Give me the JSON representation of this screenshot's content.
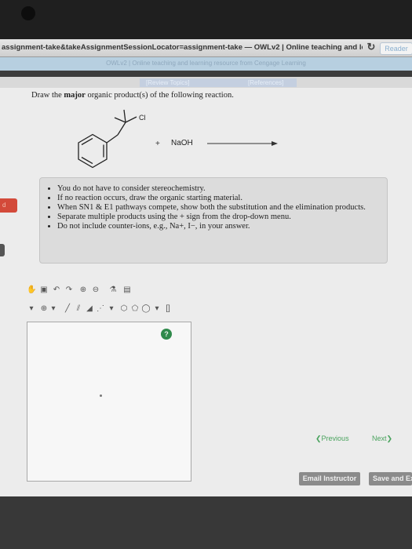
{
  "browser": {
    "address": "assignment-take&takeAssignmentSessionLocator=assignment-take — OWLv2 | Online teaching and learnin...",
    "reader_label": "Reader",
    "course_header": "OWLv2 | Online teaching and learning resource from Cengage Learning"
  },
  "links": {
    "review_topics": "[Review Topics]",
    "references": "[References]"
  },
  "question": {
    "prefix": "Draw the ",
    "bold": "major",
    "suffix": " organic product(s) of the following reaction.",
    "substituent_label": "Cl",
    "plus": "+",
    "reagent": "NaOH"
  },
  "instructions": {
    "items": [
      "You do not have to consider stereochemistry.",
      "If no reaction occurs, draw the organic starting material.",
      "When SN1 & E1 pathways compete, show both the substitution and the elimination products.",
      "Separate multiple products using the + sign from the drop-down menu.",
      "Do not include counter-ions, e.g., Na+, I−, in your answer."
    ]
  },
  "side_tab_label": "d",
  "editor": {
    "help_label": "?"
  },
  "nav": {
    "previous": "Previous",
    "next": "Next"
  },
  "footer": {
    "email": "Email Instructor",
    "save": "Save and Exit"
  }
}
